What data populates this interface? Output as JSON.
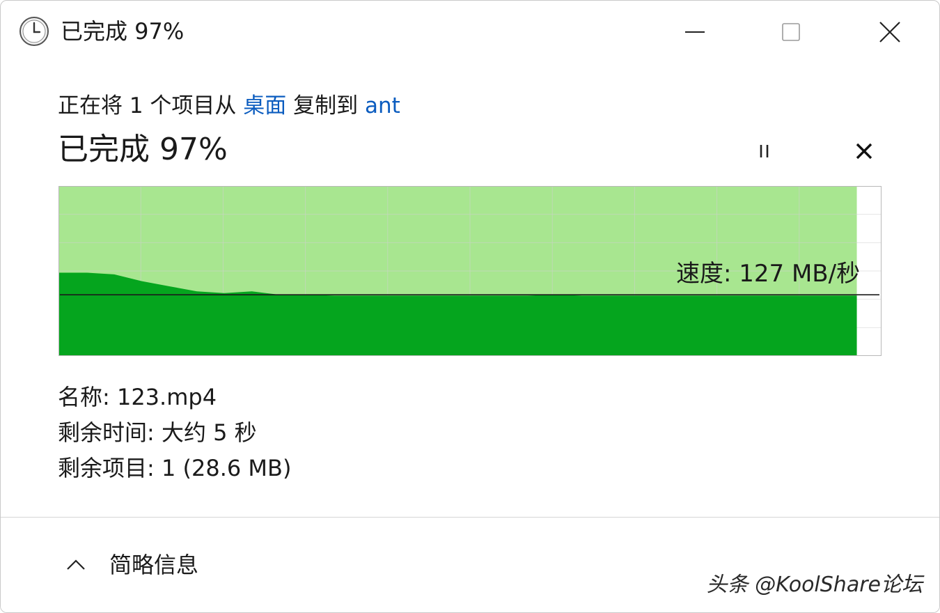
{
  "window": {
    "title": "已完成 97%",
    "icon": "clock-icon"
  },
  "header": {
    "copy_prefix": "正在将 1 个项目从 ",
    "source": "桌面",
    "copy_middle": " 复制到 ",
    "destination": "ant",
    "progress_text": "已完成 97%",
    "progress_percent": 97
  },
  "controls": {
    "pause_icon": "pause-icon",
    "cancel_icon": "close-icon"
  },
  "graph": {
    "speed_label": "速度: 127 MB/秒",
    "current_speed_fraction": 0.36,
    "completed_fraction": 0.97,
    "speed_history": [
      0.49,
      0.49,
      0.48,
      0.44,
      0.41,
      0.38,
      0.37,
      0.38,
      0.36,
      0.36,
      0.355,
      0.355,
      0.355,
      0.355,
      0.355,
      0.355,
      0.355,
      0.355,
      0.36,
      0.355,
      0.355,
      0.355,
      0.355,
      0.355,
      0.355,
      0.355,
      0.355,
      0.355,
      0.355,
      0.355
    ]
  },
  "details": {
    "name": "名称: 123.mp4",
    "time_remaining": "剩余时间: 大约 5 秒",
    "items_remaining": "剩余项目: 1 (28.6 MB)"
  },
  "footer": {
    "toggle_label": "简略信息",
    "toggle_icon": "chevron-up-icon"
  },
  "watermark": "头条 @KoolShare论坛",
  "colors": {
    "graph_light": "#a8e690",
    "graph_dark": "#05a51e",
    "link": "#0b5cbf"
  }
}
